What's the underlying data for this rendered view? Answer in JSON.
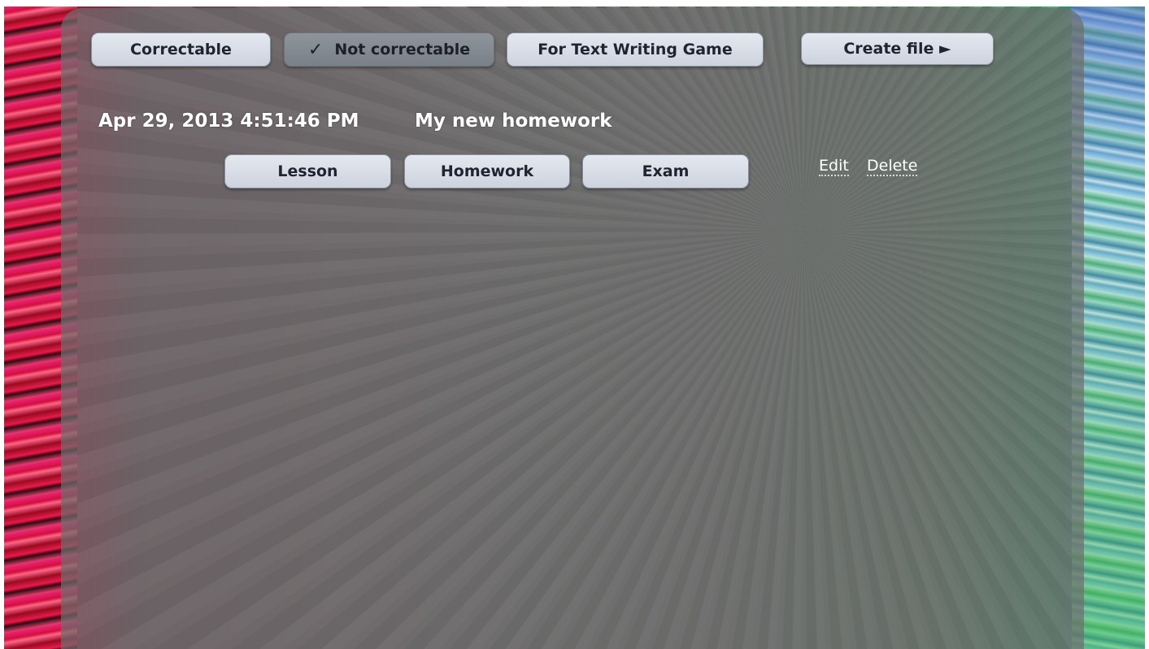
{
  "filters": {
    "correctable_label": "Correctable",
    "not_correctable_check": "✓",
    "not_correctable_label": "Not correctable",
    "text_writing_label": "For Text Writing Game",
    "create_file_label": "Create file ►",
    "selected": "Not correctable"
  },
  "item": {
    "timestamp": "Apr 29, 2013 4:51:46 PM",
    "title": "My new homework",
    "buttons": {
      "lesson": "Lesson",
      "homework": "Homework",
      "exam": "Exam"
    },
    "actions": {
      "edit": "Edit",
      "delete": "Delete"
    }
  }
}
